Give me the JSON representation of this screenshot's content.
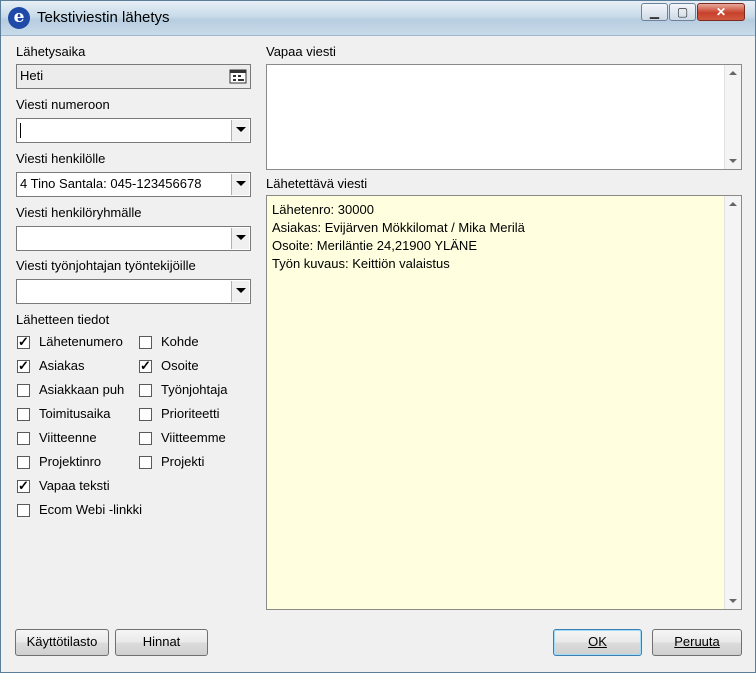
{
  "window": {
    "title": "Tekstiviestin lähetys",
    "min_glyph": "▁",
    "max_glyph": "▢",
    "close_glyph": "✕"
  },
  "left": {
    "send_time_label": "Lähetysaika",
    "send_time_value": "Heti",
    "to_number_label": "Viesti numeroon",
    "to_number_value": "",
    "to_person_label": "Viesti henkilölle",
    "to_person_value": "4 Tino Santala: 045-123456678",
    "to_group_label": "Viesti henkilöryhmälle",
    "to_group_value": "",
    "to_foreman_label": "Viesti työnjohtajan työntekijöille",
    "to_foreman_value": "",
    "order_info_label": "Lähetteen tiedot",
    "checkboxes": [
      {
        "label": "Lähetenumero",
        "checked": true
      },
      {
        "label": "Kohde",
        "checked": false
      },
      {
        "label": "Asiakas",
        "checked": true
      },
      {
        "label": "Osoite",
        "checked": true
      },
      {
        "label": "Asiakkaan puh",
        "checked": false
      },
      {
        "label": "Työnjohtaja",
        "checked": false
      },
      {
        "label": "Toimitusaika",
        "checked": false
      },
      {
        "label": "Prioriteetti",
        "checked": false
      },
      {
        "label": "Viitteenne",
        "checked": false
      },
      {
        "label": "Viitteemme",
        "checked": false
      },
      {
        "label": "Projektinro",
        "checked": false
      },
      {
        "label": "Projekti",
        "checked": false
      },
      {
        "label": "Vapaa teksti",
        "checked": true
      },
      {
        "label": "Ecom Webi -linkki",
        "checked": false
      }
    ]
  },
  "right": {
    "free_message_label": "Vapaa viesti",
    "free_message_value": "",
    "outgoing_label": "Lähetettävä viesti",
    "outgoing_lines": [
      "Lähetenro: 30000",
      "Asiakas: Evijärven Mökkilomat / Mika Merilä",
      "Osoite: Meriläntie 24,21900 YLÄNE",
      "Työn kuvaus: Keittiön valaistus"
    ]
  },
  "buttons": {
    "usage_stats": "Käyttötilasto",
    "prices": "Hinnat",
    "ok": "OK",
    "cancel": "Peruuta"
  }
}
